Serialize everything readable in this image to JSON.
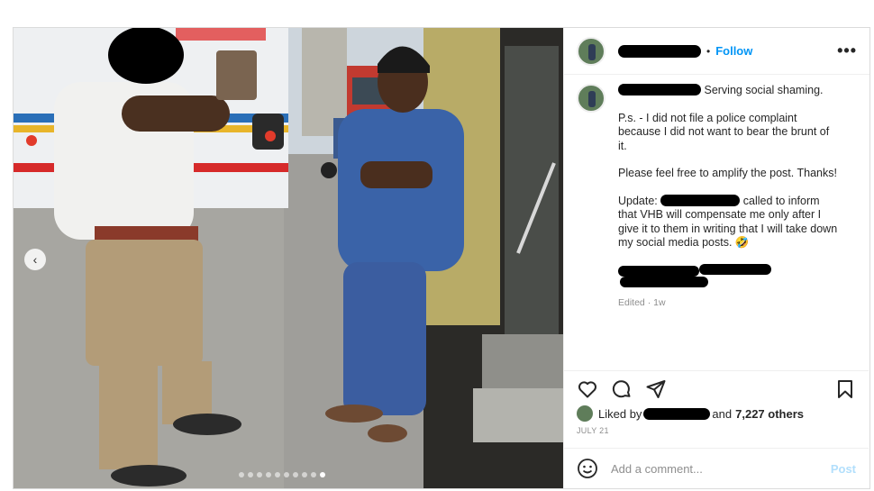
{
  "post": {
    "follow_separator": "•",
    "follow_label": "Follow",
    "more_label": "•••",
    "caption": {
      "line1": "Serving social shaming.",
      "p1": "P.s. - I did not file a police complaint because I did not want to bear the brunt of it.",
      "p2": "Please feel free to amplify the post. Thanks!",
      "update_prefix": "Update:",
      "update_after_redaction": "called to",
      "update_rest": "inform that VHB will compensate me only after I give it to them in writing that I will take down my social media posts. 🤣",
      "edited": "Edited · 1w"
    },
    "likes": {
      "prefix": "Liked by",
      "and_text": "and",
      "count": "7,227 others"
    },
    "date": "JULY 21",
    "comment": {
      "placeholder": "Add a comment...",
      "post_label": "Post"
    },
    "carousel": {
      "prev_symbol": "‹",
      "slide_count": 10,
      "active_index": 9
    }
  },
  "icons": [
    "heart-icon",
    "comment-icon",
    "share-icon",
    "bookmark-icon",
    "emoji-icon",
    "chevron-left-icon"
  ],
  "colors": {
    "follow": "#0095f6",
    "post_disabled": "#b2dffc",
    "muted": "#8e8e8e",
    "text": "#262626"
  }
}
